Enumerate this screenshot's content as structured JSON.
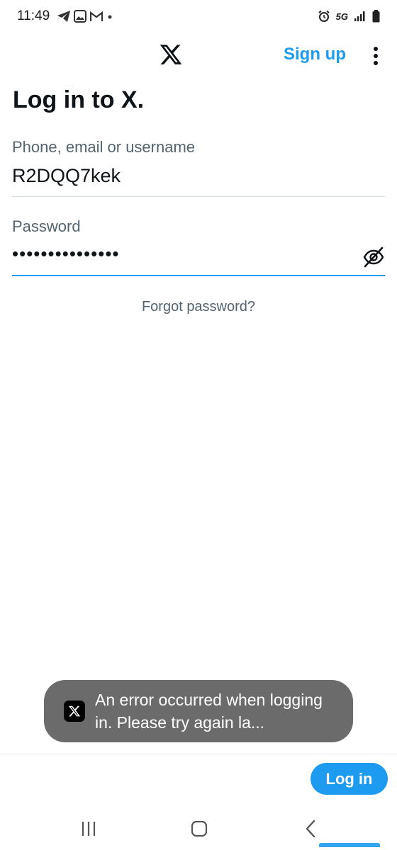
{
  "status_bar": {
    "time": "11:49",
    "network": "5G",
    "left_icons": [
      "telegram-icon",
      "gallery-icon",
      "gmail-icon",
      "dot-icon"
    ],
    "right_icons": [
      "alarm-icon",
      "5g-icon",
      "signal-icon",
      "battery-icon"
    ]
  },
  "app_bar": {
    "logo": "x-logo-icon",
    "signup_label": "Sign up",
    "menu_icon": "more-vertical-icon"
  },
  "page": {
    "title": "Log in to X."
  },
  "form": {
    "username_label": "Phone, email or username",
    "username_value": "R2DQQ7kek",
    "password_label": "Password",
    "password_masked": "•••••••••••••••",
    "toggle_icon": "eye-off-icon",
    "forgot_label": "Forgot password?"
  },
  "toast": {
    "icon": "x-logo-icon",
    "message": "An error occurred when logging in. Please try again la..."
  },
  "footer": {
    "login_label": "Log in"
  },
  "nav_bar": {
    "icons": [
      "recents-icon",
      "home-icon",
      "back-icon"
    ]
  },
  "colors": {
    "accent": "#1d9bf0",
    "text_primary": "#0f1419",
    "text_secondary": "#536471",
    "toast_bg": "#6b6b6b"
  }
}
